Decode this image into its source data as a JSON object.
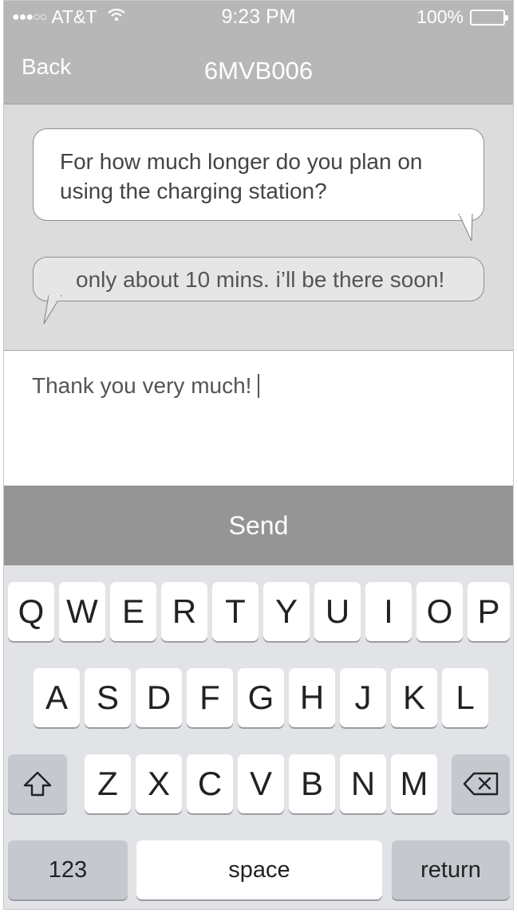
{
  "status_bar": {
    "signal": "●●●○○",
    "carrier": "AT&T",
    "wifi_icon": "wifi-icon",
    "time": "9:23 PM",
    "battery": "100%",
    "battery_level": 1.0
  },
  "nav": {
    "back_label": "Back",
    "title": "6MVB006"
  },
  "messages": [
    {
      "direction": "outgoing",
      "lines": [
        "For how much longer do you plan on",
        "using the charging station?"
      ]
    },
    {
      "direction": "incoming",
      "text": "only about 10 mins. i’ll be there soon!"
    }
  ],
  "compose": {
    "value": "Thank you very much!"
  },
  "send_label": "Send",
  "keyboard": {
    "row1": [
      "Q",
      "W",
      "E",
      "R",
      "T",
      "Y",
      "U",
      "I",
      "O",
      "P"
    ],
    "row2": [
      "A",
      "S",
      "D",
      "F",
      "G",
      "H",
      "J",
      "K",
      "L"
    ],
    "row3": [
      "Z",
      "X",
      "C",
      "V",
      "B",
      "N",
      "M"
    ],
    "shift_icon": "shift-icon",
    "delete_icon": "delete-icon",
    "numbers_label": "123",
    "space_label": "space",
    "return_label": "return"
  }
}
